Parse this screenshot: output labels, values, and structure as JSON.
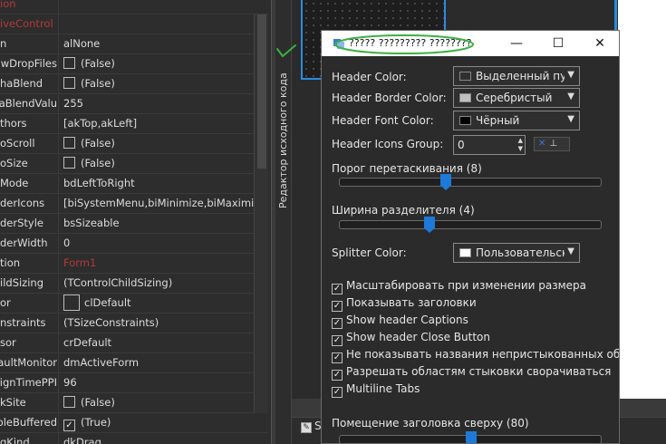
{
  "inspector": {
    "rows": [
      {
        "name": "ion",
        "value": "",
        "name_red": true
      },
      {
        "name": "iveControl",
        "value": "",
        "name_red": true
      },
      {
        "name": "n",
        "value": "alNone"
      },
      {
        "name": "owDropFiles",
        "value": "(False)",
        "checkbox": "off"
      },
      {
        "name": "haBlend",
        "value": "(False)",
        "checkbox": "off"
      },
      {
        "name": "haBlendValu",
        "value": "255"
      },
      {
        "name": "thors",
        "value": "[akTop,akLeft]"
      },
      {
        "name": "oScroll",
        "value": "(False)",
        "checkbox": "off"
      },
      {
        "name": "oSize",
        "value": "(False)",
        "checkbox": "off"
      },
      {
        "name": "Mode",
        "value": "bdLeftToRight"
      },
      {
        "name": "derIcons",
        "value": "[biSystemMenu,biMinimize,biMaximize"
      },
      {
        "name": "derStyle",
        "value": "bsSizeable"
      },
      {
        "name": "derWidth",
        "value": "0"
      },
      {
        "name": "tion",
        "value": "Form1",
        "value_red": true
      },
      {
        "name": "ildSizing",
        "value": "(TControlChildSizing)"
      },
      {
        "name": "or",
        "value": "clDefault",
        "color_box": true
      },
      {
        "name": "nstraints",
        "value": "(TSizeConstraints)"
      },
      {
        "name": "sor",
        "value": "crDefault"
      },
      {
        "name": "aultMonitor",
        "value": "dmActiveForm"
      },
      {
        "name": "ignTimePPI",
        "value": "96"
      },
      {
        "name": "kSite",
        "value": "(False)",
        "checkbox": "off"
      },
      {
        "name": "ableBuffered",
        "value": "(True)",
        "checkbox": "on"
      },
      {
        "name": "gKind",
        "value": "dkDrag"
      }
    ]
  },
  "editor": {
    "side_tab_label": "Редактор исходного кода",
    "status_label": "S"
  },
  "dialog": {
    "title": "????? ????????? ????????",
    "minimize_glyph": "—",
    "maximize_glyph": "☐",
    "close_glyph": "✕",
    "header_color": {
      "label": "Header Color:",
      "value": "Выделенный пункт",
      "swatch": "#2f2f2f"
    },
    "header_border_color": {
      "label": "Header Border Color:",
      "value": "Серебристый",
      "swatch": "#c0c0c0"
    },
    "header_font_color": {
      "label": "Header Font Color:",
      "value": "Чёрный",
      "swatch": "#000000"
    },
    "header_icons_group": {
      "label": "Header Icons Group:",
      "value": "0"
    },
    "drag_threshold": {
      "label": "Порог перетаскивания (8)",
      "value": 8,
      "min": 0,
      "max": 20
    },
    "splitter_width": {
      "label": "Ширина разделителя (4)",
      "value": 4,
      "min": 0,
      "max": 12
    },
    "splitter_color": {
      "label": "Splitter Color:",
      "value": "Пользовательский",
      "swatch": "#ffffff"
    },
    "checkboxes": [
      {
        "label": "Масштабировать при изменении размера",
        "checked": true
      },
      {
        "label": "Показывать заголовки",
        "checked": true
      },
      {
        "label": "Show header Captions",
        "checked": true
      },
      {
        "label": "Show header Close Button",
        "checked": true
      },
      {
        "label": "Не показывать названия непристыкованных объектов",
        "checked": true
      },
      {
        "label": "Разрешать областям стыковки сворачиваться",
        "checked": true
      },
      {
        "label": "Multiline Tabs",
        "checked": true
      }
    ],
    "header_caption_space": {
      "label": "Помещение заголовка сверху (80)",
      "value": 80,
      "min": 0,
      "max": 160
    }
  },
  "colors": {
    "accent": "#1e7ad8",
    "annotation": "#3cb043",
    "error_red": "#b23a3a"
  }
}
